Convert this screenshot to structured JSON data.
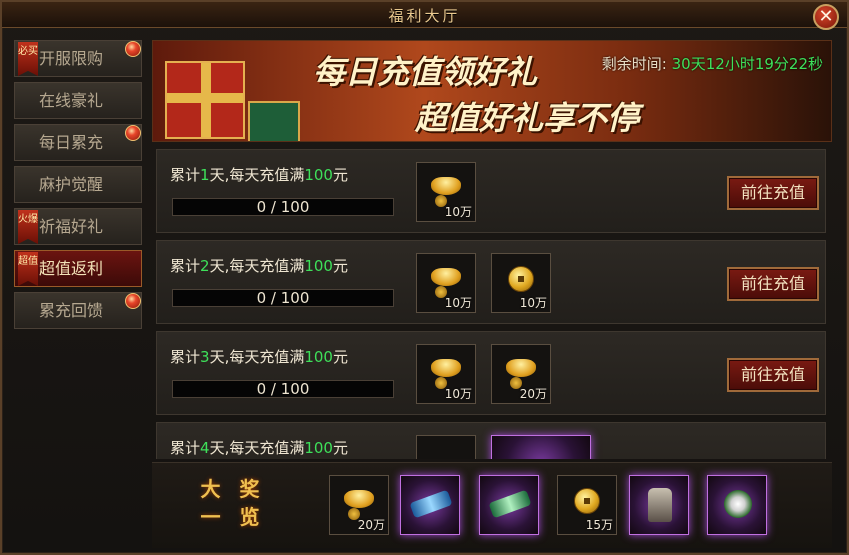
{
  "window": {
    "title": "福利大厅",
    "close_label": "✕"
  },
  "sidebar": {
    "items": [
      {
        "label": "开服限购",
        "ribbon": "必买",
        "dot": true,
        "active": false
      },
      {
        "label": "在线豪礼",
        "ribbon": "",
        "dot": false,
        "active": false
      },
      {
        "label": "每日累充",
        "ribbon": "",
        "dot": true,
        "active": false
      },
      {
        "label": "麻护觉醒",
        "ribbon": "",
        "dot": false,
        "active": false
      },
      {
        "label": "祈福好礼",
        "ribbon": "火爆",
        "dot": false,
        "active": false
      },
      {
        "label": "超值返利",
        "ribbon": "超值",
        "dot": false,
        "active": true
      },
      {
        "label": "累充回馈",
        "ribbon": "",
        "dot": true,
        "active": false
      }
    ]
  },
  "banner": {
    "line1": "每日充值领好礼",
    "line2": "超值好礼享不停",
    "countdown_label": "剩余时间:",
    "countdown_value": "30天12小时19分22秒"
  },
  "rows": [
    {
      "prefix": "累计",
      "days": "1",
      "middle": "天,每天充值满",
      "amount": "100",
      "suffix": "元",
      "progress": "0 / 100",
      "button": "前往充值",
      "rewards": [
        {
          "icon": "gold-ingot-icon",
          "amount": "10万"
        }
      ]
    },
    {
      "prefix": "累计",
      "days": "2",
      "middle": "天,每天充值满",
      "amount": "100",
      "suffix": "元",
      "progress": "0 / 100",
      "button": "前往充值",
      "rewards": [
        {
          "icon": "gold-ingot-icon",
          "amount": "10万"
        },
        {
          "icon": "gold-coin-icon",
          "amount": "10万"
        }
      ]
    },
    {
      "prefix": "累计",
      "days": "3",
      "middle": "天,每天充值满",
      "amount": "100",
      "suffix": "元",
      "progress": "0 / 100",
      "button": "前往充值",
      "rewards": [
        {
          "icon": "gold-ingot-icon",
          "amount": "10万"
        },
        {
          "icon": "gold-ingot-icon",
          "amount": "20万"
        }
      ]
    },
    {
      "prefix": "累计",
      "days": "4",
      "middle": "天,每天充值满",
      "amount": "100",
      "suffix": "元"
    }
  ],
  "grand_prize": {
    "title_line1": "大 奖",
    "title_line2": "一 览",
    "items": [
      {
        "icon": "gold-ingot-icon",
        "amount": "20万"
      },
      {
        "icon": "blue-rune-icon",
        "amount": ""
      },
      {
        "icon": "green-rune-icon",
        "amount": ""
      },
      {
        "icon": "gold-coin-icon",
        "amount": "15万"
      },
      {
        "icon": "armor-icon",
        "amount": ""
      },
      {
        "icon": "white-flower-icon",
        "amount": ""
      }
    ]
  },
  "colors": {
    "highlight_green": "#3ee05a",
    "active_tab": "#6b1410",
    "button_red": "#7a1a12"
  }
}
